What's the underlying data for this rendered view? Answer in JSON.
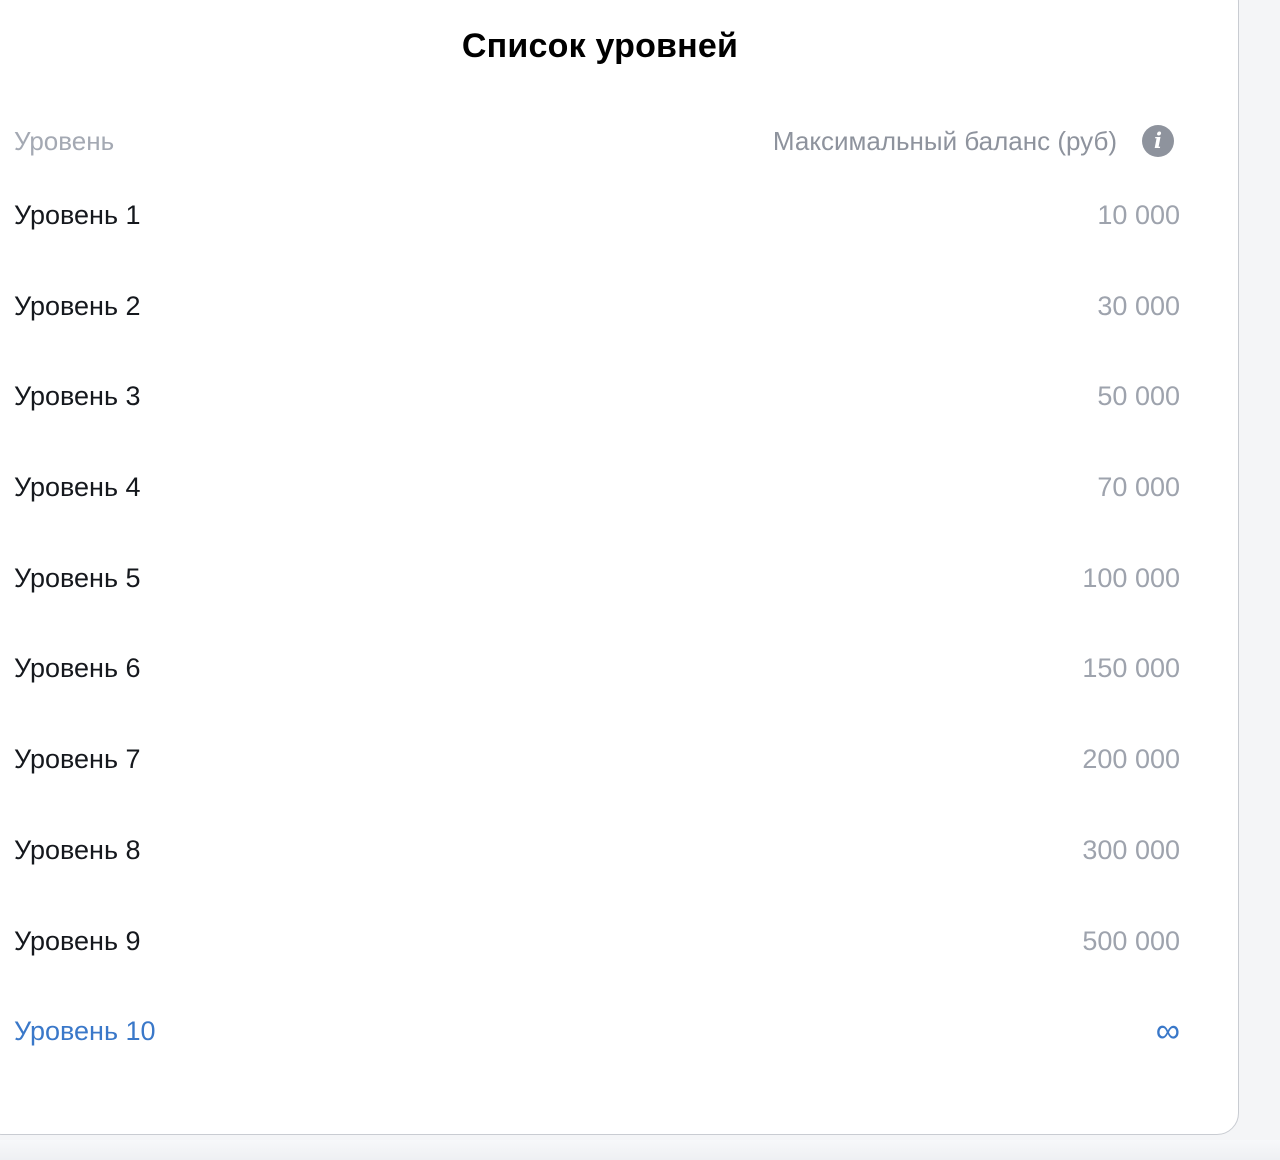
{
  "title": "Список уровней",
  "table": {
    "columns": {
      "level": "Уровень",
      "max_balance": "Максимальный баланс (руб)"
    },
    "info_icon": "info-icon",
    "info_icon_glyph": "i",
    "rows": [
      {
        "level": "Уровень 1",
        "max_balance": "10 000"
      },
      {
        "level": "Уровень 2",
        "max_balance": "30 000"
      },
      {
        "level": "Уровень 3",
        "max_balance": "50 000"
      },
      {
        "level": "Уровень 4",
        "max_balance": "70 000"
      },
      {
        "level": "Уровень 5",
        "max_balance": "100 000"
      },
      {
        "level": "Уровень 6",
        "max_balance": "150 000"
      },
      {
        "level": "Уровень 7",
        "max_balance": "200 000"
      },
      {
        "level": "Уровень 8",
        "max_balance": "300 000"
      },
      {
        "level": "Уровень 9",
        "max_balance": "500 000"
      },
      {
        "level": "Уровень 10",
        "max_balance": "∞"
      }
    ],
    "highlighted_row": 9
  },
  "colors": {
    "accent": "#3a78c9",
    "header_text": "#a4a9b3",
    "value_text": "#9ea3ad",
    "label_text": "#15181d",
    "icon_bg": "#8e939d"
  }
}
